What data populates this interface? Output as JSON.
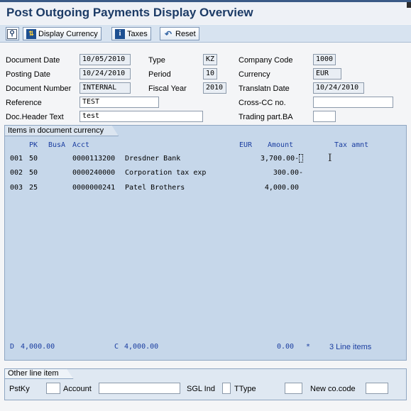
{
  "window": {
    "title": "Post Outgoing Payments Display Overview"
  },
  "toolbar": {
    "display_currency_label": "Display Currency",
    "taxes_label": "Taxes",
    "reset_label": "Reset"
  },
  "header": {
    "document_date_label": "Document Date",
    "document_date": "10/05/2010",
    "type_label": "Type",
    "type": "KZ",
    "company_code_label": "Company Code",
    "company_code": "1000",
    "posting_date_label": "Posting Date",
    "posting_date": "10/24/2010",
    "period_label": "Period",
    "period": "10",
    "currency_label": "Currency",
    "currency": "EUR",
    "document_number_label": "Document Number",
    "document_number": "INTERNAL",
    "fiscal_year_label": "Fiscal Year",
    "fiscal_year": "2010",
    "translatn_date_label": "Translatn Date",
    "translatn_date": "10/24/2010",
    "reference_label": "Reference",
    "reference": "TEST",
    "cross_cc_label": "Cross-CC no.",
    "cross_cc": "",
    "doc_header_text_label": "Doc.Header Text",
    "doc_header_text": "test",
    "trading_part_label": "Trading part.BA",
    "trading_part": ""
  },
  "items": {
    "tab_label": "Items in document currency",
    "columns": {
      "pk": "PK",
      "busa": "BusA",
      "acct": "Acct",
      "eur": "EUR",
      "amount": "Amount",
      "tax": "Tax amnt"
    },
    "rows": [
      {
        "line": "001",
        "pk": "50",
        "acct": "0000113200",
        "name": "Dresdner Bank",
        "amount": "3,700.00-"
      },
      {
        "line": "002",
        "pk": "50",
        "acct": "0000240000",
        "name": "Corporation tax exp",
        "amount": "300.00-"
      },
      {
        "line": "003",
        "pk": "25",
        "acct": "0000000241",
        "name": "Patel Brothers",
        "amount": "4,000.00"
      }
    ],
    "totals": {
      "debit_label": "D",
      "debit": "4,000.00",
      "credit_label": "C",
      "credit": "4,000.00",
      "balance": "0.00",
      "balance_marker": "*",
      "line_items": "3 Line items"
    }
  },
  "other_line_item": {
    "tab_label": "Other line item",
    "pstky_label": "PstKy",
    "pstky": "",
    "account_label": "Account",
    "account": "",
    "sgl_ind_label": "SGL Ind",
    "sgl_ind": "",
    "ttype_label": "TType",
    "ttype": "",
    "new_co_code_label": "New co.code",
    "new_co_code": ""
  }
}
